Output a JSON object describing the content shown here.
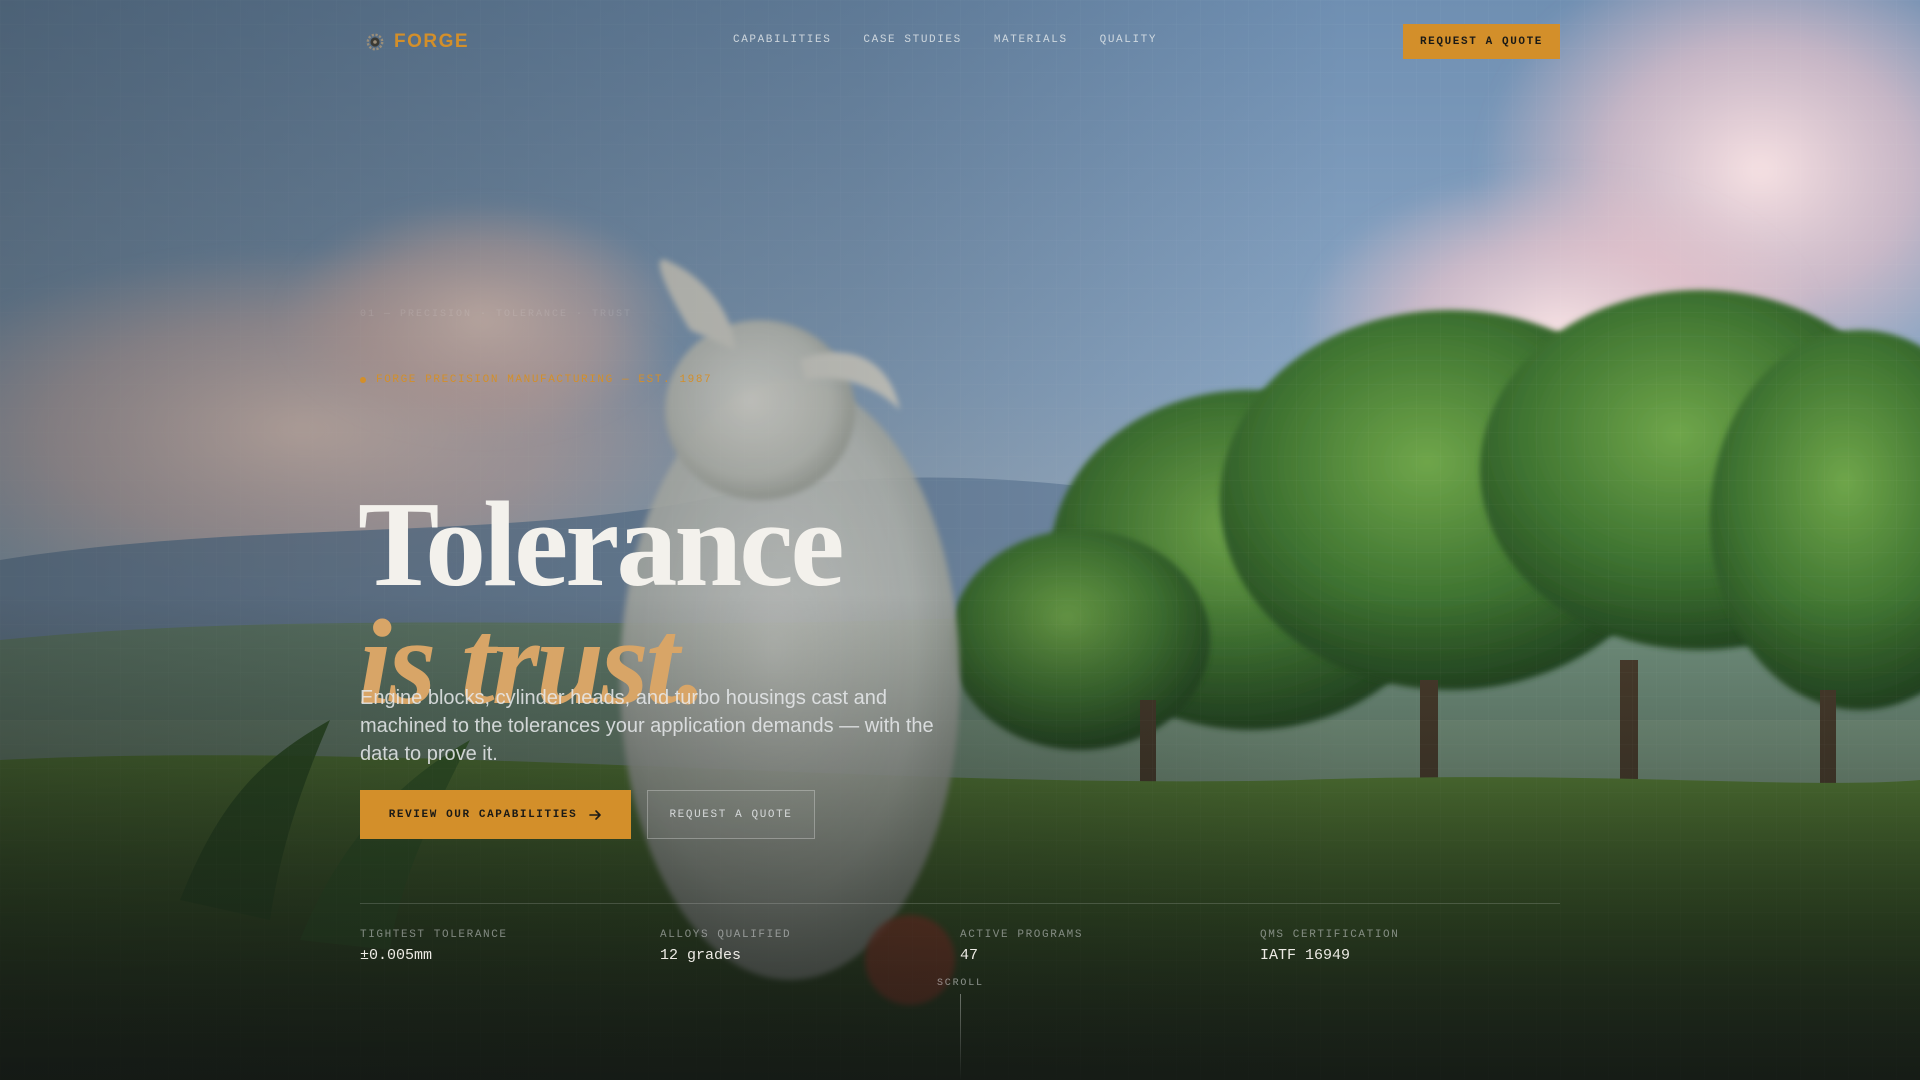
{
  "brand": {
    "name": "FORGE",
    "icon": "gear-logo-icon"
  },
  "nav": {
    "links": [
      "CAPABILITIES",
      "CASE STUDIES",
      "MATERIALS",
      "QUALITY"
    ],
    "cta_label": "REQUEST A QUOTE"
  },
  "hero": {
    "faint_line": "01 — PRECISION · TOLERANCE · TRUST",
    "eyebrow": "FORGE PRECISION MANUFACTURING — EST. 1987",
    "headline_line1": "Tolerance",
    "headline_line2": "is trust.",
    "lede": "Engine blocks, cylinder heads, and turbo housings cast and machined to the tolerances your application demands — with the data to prove it.",
    "primary_button": "REVIEW OUR CAPABILITIES",
    "secondary_button": "REQUEST A QUOTE",
    "primary_icon": "arrow-right-icon"
  },
  "stats": [
    {
      "label": "TIGHTEST TOLERANCE",
      "value": "±0.005mm"
    },
    {
      "label": "ALLOYS QUALIFIED",
      "value": "12 grades"
    },
    {
      "label": "ACTIVE PROGRAMS",
      "value": "47"
    },
    {
      "label": "QMS CERTIFICATION",
      "value": "IATF 16949"
    }
  ],
  "scroll_label": "SCROLL",
  "colors": {
    "accent": "#d38f2a",
    "headline": "#f3f1ec",
    "headline_italic": "#d8a567"
  }
}
